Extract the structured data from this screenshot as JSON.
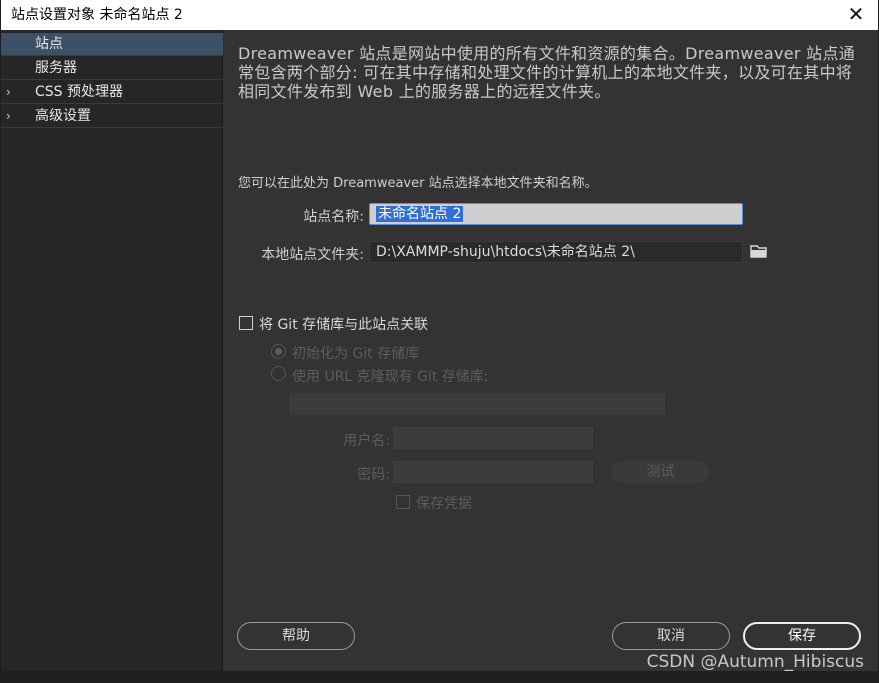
{
  "window": {
    "title": "站点设置对象 未命名站点 2",
    "close_glyph": "✕"
  },
  "sidebar": {
    "items": [
      {
        "label": "站点",
        "has_arrow": false,
        "selected": true
      },
      {
        "label": "服务器",
        "has_arrow": false,
        "selected": false
      },
      {
        "label": "CSS 预处理器",
        "has_arrow": true,
        "selected": false
      },
      {
        "label": "高级设置",
        "has_arrow": true,
        "selected": false
      }
    ],
    "arrow_glyph": "›"
  },
  "main": {
    "description": "Dreamweaver 站点是网站中使用的所有文件和资源的集合。Dreamweaver 站点通常包含两个部分: 可在其中存储和处理文件的计算机上的本地文件夹，以及可在其中将相同文件发布到 Web 上的服务器上的远程文件夹。",
    "hint": "您可以在此处为 Dreamweaver 站点选择本地文件夹和名称。",
    "site_name_label": "站点名称:",
    "site_name_value": "未命名站点 2",
    "local_folder_label": "本地站点文件夹:",
    "local_folder_value": "D:\\XAMMP-shuju\\htdocs\\未命名站点 2\\",
    "git": {
      "associate_label": "将 Git 存储库与此站点关联",
      "init_label": "初始化为 Git 存储库",
      "clone_label": "使用 URL 克隆现有 Git 存储库:",
      "username_label": "用户名:",
      "password_label": "密码:",
      "test_label": "测试",
      "save_credentials_label": "保存凭据"
    }
  },
  "footer": {
    "help_label": "帮助",
    "cancel_label": "取消",
    "save_label": "保存"
  },
  "watermark": "CSDN @Autumn_Hibiscus",
  "colors": {
    "selected_item": "#3d5066",
    "selection_highlight": "#2f6fd6"
  }
}
